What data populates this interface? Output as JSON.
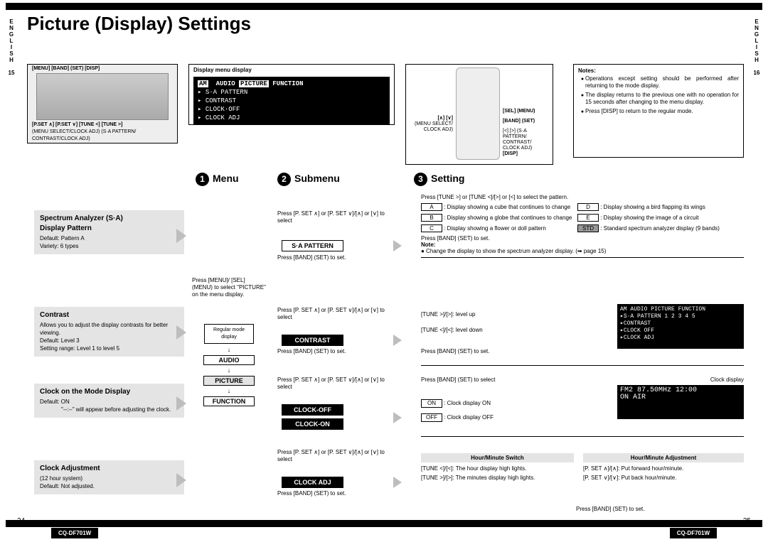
{
  "page": {
    "title": "Picture (Display) Settings",
    "lang_left": "ENGLISH",
    "lang_right": "ENGLISH",
    "pagenum_left_side": "15",
    "pagenum_right_side": "16",
    "pagenum_footer_left": "24",
    "pagenum_footer_right": "25",
    "model": "CQ-DF701W"
  },
  "headunit": {
    "top_labels": "[MENU] [BAND] (SET)          [DISP]",
    "bottom1": "[P.SET ∧] [P.SET ∨]    [TUNE <] [TUNE >]",
    "bottom2": "(MENU SELECT/CLOCK ADJ) (S·A PATTERN/",
    "bottom3": "                        CONTRAST/CLOCK ADJ)"
  },
  "dispmenu": {
    "caption": "Display menu display",
    "line_hdr_1": "AM",
    "line_hdr_2": "AUDIO",
    "line_hdr_3": "PICTURE",
    "line_hdr_4": "FUNCTION",
    "line2": "▸ S·A PATTERN",
    "line3": "▸ CONTRAST",
    "line4": "▸ CLOCK·OFF",
    "line5": "▸ CLOCK ADJ"
  },
  "remote": {
    "left1": "[∧] [∨]",
    "left1b": "(MENU SELECT/ CLOCK ADJ)",
    "right1": "[SEL] (MENU)",
    "right2": "[BAND] (SET)",
    "right3": "[<] [>] (S·A PATTERN/ CONTRAST/ CLOCK ADJ)",
    "right4": "[DISP]"
  },
  "notes": {
    "heading": "Notes:",
    "n1": "Operations except setting should be performed after returning to the mode display.",
    "n2": "The display returns to the previous one with no operation for 15 seconds after changing to the menu display.",
    "n3": "Press [DISP] to return to the regular mode."
  },
  "steps": {
    "s1": "Menu",
    "s2": "Submenu",
    "s3": "Setting"
  },
  "features": {
    "sa": {
      "t1": "Spectrum Analyzer (S·A)",
      "t2": "Display Pattern",
      "d1": "Default: Pattern A",
      "d2": "Variety: 6 types"
    },
    "contrast": {
      "t": "Contrast",
      "d1": "Allows you to adjust the display contrasts for better viewing.",
      "d2": "Default: Level 3",
      "d3": "Setting range: Level 1 to level 5"
    },
    "clockmode": {
      "t": "Clock on the Mode Display",
      "d1": "Default: ON",
      "d2": "\"--:--\" will appear before adjusting the clock."
    },
    "clockadj": {
      "t": "Clock Adjustment",
      "d1": "(12 hour system)",
      "d2": "Default: Not adjusted."
    }
  },
  "menu": {
    "instr": "Press [MENU]/ [SEL] (MENU) to select \"PICTURE\" on the menu display.",
    "rm": "Regular mode display",
    "tag1": "AUDIO",
    "tag2": "PICTURE",
    "tag3": "FUNCTION"
  },
  "submenu": {
    "press_top": "Press [P. SET ∧] or [P. SET ∨]/[∧] or [∨] to select",
    "press_band": "Press [BAND] (SET) to set.",
    "pill_sa": "S·A PATTERN",
    "pill_contrast": "CONTRAST",
    "pill_clockoff": "CLOCK-OFF",
    "pill_clockon": "CLOCK-ON",
    "pill_clockadj": "CLOCK ADJ"
  },
  "setting": {
    "intro": "Press [TUNE >] or [TUNE <]/[>] or [<] to select the pattern.",
    "rows": {
      "A": ": Display showing a cube that continues to change",
      "B": ": Display showing a globe that continues to change",
      "C": ": Display showing a flower or doll pattern",
      "D": ": Display showing a bird flapping its wings",
      "E": ": Display showing the image of a circuit",
      "STD": ": Standard spectrum analyzer display (9 bands)"
    },
    "press_band_set": "Press [BAND] (SET) to set.",
    "note_hdr": "Note:",
    "note1": "● Change the display to show the spectrum analyzer display. (➡ page 15)",
    "contrast_up": "[TUNE >]/[>]: level up",
    "contrast_down": "[TUNE <]/[<]: level down",
    "clock_press": "Press [BAND] (SET) to select",
    "clock_lbl": "Clock display",
    "on": "ON",
    "on_d": ": Clock display ON",
    "off": "OFF",
    "off_d": ": Clock display OFF",
    "hm_sw": "Hour/Minute Switch",
    "hm_sw1": "[TUNE <]/[<]: The hour display high lights.",
    "hm_sw2": "[TUNE >]/[>]: The minutes display high lights.",
    "hm_adj": "Hour/Minute Adjustment",
    "hm_adj1": "[P. SET ∧]/[∧]: Put forward hour/minute.",
    "hm_adj2": "[P. SET ∨]/[∨]: Put back hour/minute.",
    "hm_foot": "Press [BAND] (SET) to set."
  },
  "screens": {
    "contrast": "AM  AUDIO PICTURE FUNCTION\n▸S·A PATTERN   1 2 3 4 5\n▸CONTRAST\n▸CLOCK OFF\n▸CLOCK ADJ",
    "clock": "FM2       87.50MHz 12:00\nON AIR"
  }
}
